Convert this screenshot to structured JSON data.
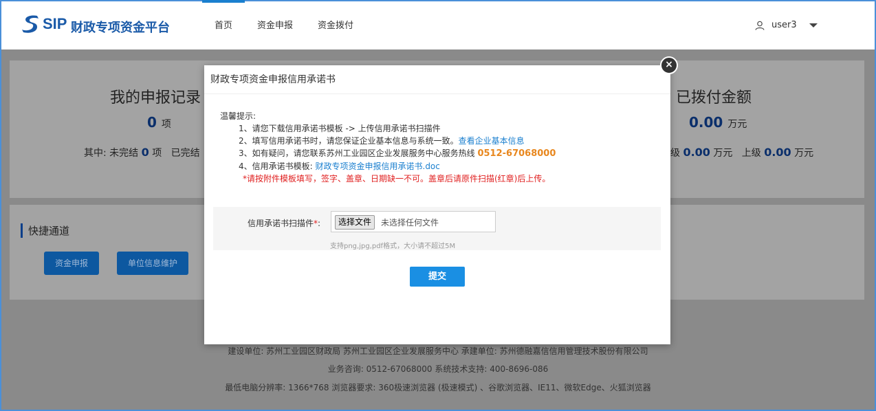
{
  "header": {
    "logo_text": "SIP",
    "app_title": "财政专项资金平台",
    "nav": [
      "首页",
      "资金申报",
      "资金拨付"
    ],
    "username": "user3"
  },
  "background": {
    "records_title": "我的申报记录",
    "records_count": "0",
    "records_unit": "项",
    "records_detail_prefix": "其中: 未完结",
    "records_unfinished": "0",
    "records_unfinished_unit": "项",
    "records_finished_prefix": "已完结",
    "paid_title": "已拨付金额",
    "paid_amount": "0.00",
    "paid_unit": "万元",
    "paid_local_prefix": "级",
    "paid_local": "0.00",
    "paid_local_unit": "万元",
    "paid_upper_prefix": "上级",
    "paid_upper": "0.00",
    "paid_upper_unit": "万元",
    "quick_title": "快捷通道",
    "quick_buttons": [
      "资金申报",
      "单位信息维护"
    ]
  },
  "footer": {
    "line1": "建设单位: 苏州工业园区财政局 苏州工业园区企业发展服务中心 承建单位: 苏州德融嘉信信用管理技术股份有限公司",
    "line2": "业务咨询: 0512-67068000 系统技术支持: 400-8696-086",
    "line3": "最低电脑分辨率: 1366*768 浏览器要求: 360极速浏览器 (极速模式) 、谷歌浏览器、IE11、微软Edge、火狐浏览器"
  },
  "modal": {
    "title": "财政专项资金申报信用承诺书",
    "close_glyph": "×",
    "tips_heading": "温馨提示:",
    "tip1": "1、请您下载信用承诺书模板 -> 上传信用承诺书扫描件",
    "tip2_text": "2、填写信用承诺书时，请您保证企业基本信息与系统一致。",
    "tip2_link": "查看企业基本信息",
    "tip3_text": "3、如有疑问，请您联系苏州工业园区企业发展服务中心服务热线 ",
    "tip3_hotline": "0512-67068000",
    "tip4_text": "4、信用承诺书模板: ",
    "tip4_link": "财政专项资金申报信用承诺书.doc",
    "warning": "*请按附件模板填写，签字、盖章、日期缺一不可。盖章后请原件扫描(红章)后上传。",
    "upload_label": "信用承诺书扫描件",
    "upload_required": "*",
    "upload_colon": ":",
    "file_button": "选择文件",
    "file_status": "未选择任何文件",
    "upload_hint": "支持png,jpg,pdf格式，大小请不超过5M",
    "submit": "提交"
  },
  "colors": {
    "brand": "#1a5aa8",
    "link": "#1a7fcf",
    "warning": "#e02020",
    "hotline": "#e8871e",
    "submit": "#1a8fe3"
  }
}
